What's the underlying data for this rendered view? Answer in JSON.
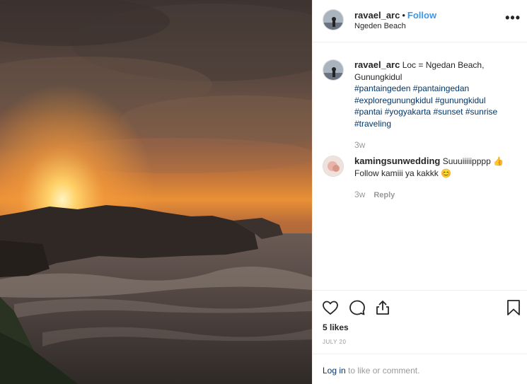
{
  "post": {
    "username": "ravael_arc",
    "separator": "•",
    "follow_label": "Follow",
    "location": "Ngeden Beach",
    "more_label": "•••"
  },
  "caption": {
    "username": "ravael_arc",
    "text": "Loc = Ngedan Beach, Gunungkidul",
    "hashtags": [
      "#pantaingeden",
      "#pantaingedan",
      "#exploregunungkidul",
      "#gunungkidul",
      "#pantai",
      "#yogyakarta",
      "#sunset",
      "#sunrise",
      "#traveling"
    ],
    "time": "3w"
  },
  "comments": [
    {
      "username": "kamingsunwedding",
      "text_line1": "Suuuiiiiipppp 👍",
      "text_line2": "Follow kamiii ya kakkk 😊",
      "time": "3w",
      "reply_label": "Reply"
    }
  ],
  "actions": {
    "like_icon": "heart-icon",
    "comment_icon": "comment-icon",
    "share_icon": "share-icon",
    "save_icon": "bookmark-icon"
  },
  "likes_text": "5 likes",
  "date": "JULY 20",
  "footer": {
    "login_label": "Log in",
    "suffix": " to like or comment."
  },
  "colors": {
    "link_blue": "#3897f0",
    "hashtag": "#003569",
    "muted": "#999999",
    "text": "#262626"
  }
}
